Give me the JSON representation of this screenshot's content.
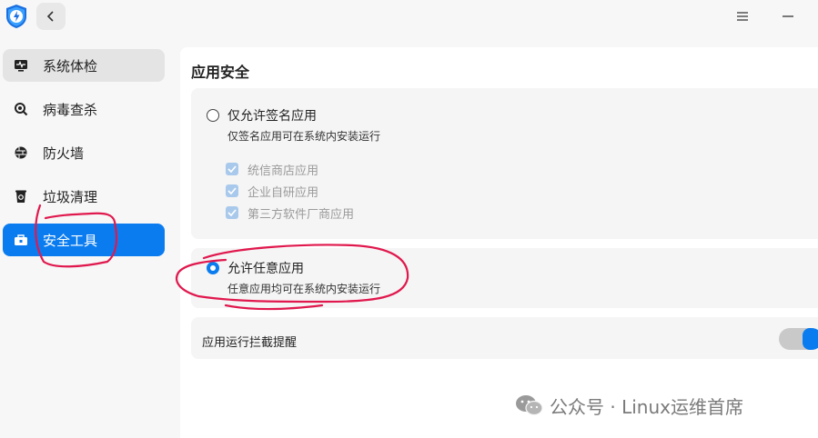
{
  "header": {
    "app_icon": "shield-lightning-icon",
    "back_icon": "chevron-left-icon",
    "menu_icon": "hamburger-menu-icon",
    "minimize_icon": "minimize-icon"
  },
  "sidebar": {
    "items": [
      {
        "label": "系统体检",
        "icon": "monitor-pulse-icon"
      },
      {
        "label": "病毒查杀",
        "icon": "virus-scan-icon"
      },
      {
        "label": "防火墙",
        "icon": "firewall-icon"
      },
      {
        "label": "垃圾清理",
        "icon": "trash-bin-icon"
      },
      {
        "label": "安全工具",
        "icon": "toolbox-icon"
      }
    ],
    "active_index": 4
  },
  "main": {
    "section_title": "应用安全",
    "option_signed": {
      "title": "仅允许签名应用",
      "description": "仅签名应用可在系统内安装运行",
      "selected": false,
      "sub_options": [
        {
          "label": "统信商店应用",
          "checked": true
        },
        {
          "label": "企业自研应用",
          "checked": true
        },
        {
          "label": "第三方软件厂商应用",
          "checked": true
        }
      ]
    },
    "option_any": {
      "title": "允许任意应用",
      "description": "任意应用均可在系统内安装运行",
      "selected": true
    },
    "toggle_row": {
      "label": "应用运行拦截提醒",
      "enabled": true
    }
  },
  "watermark": {
    "text": "公众号 · Linux运维首席",
    "icon": "wechat-icon"
  },
  "colors": {
    "accent": "#0a7cf0",
    "annotation": "#e0184d",
    "sidebar_bg": "#f7f7f7",
    "card_bg": "#f5f5f5"
  }
}
